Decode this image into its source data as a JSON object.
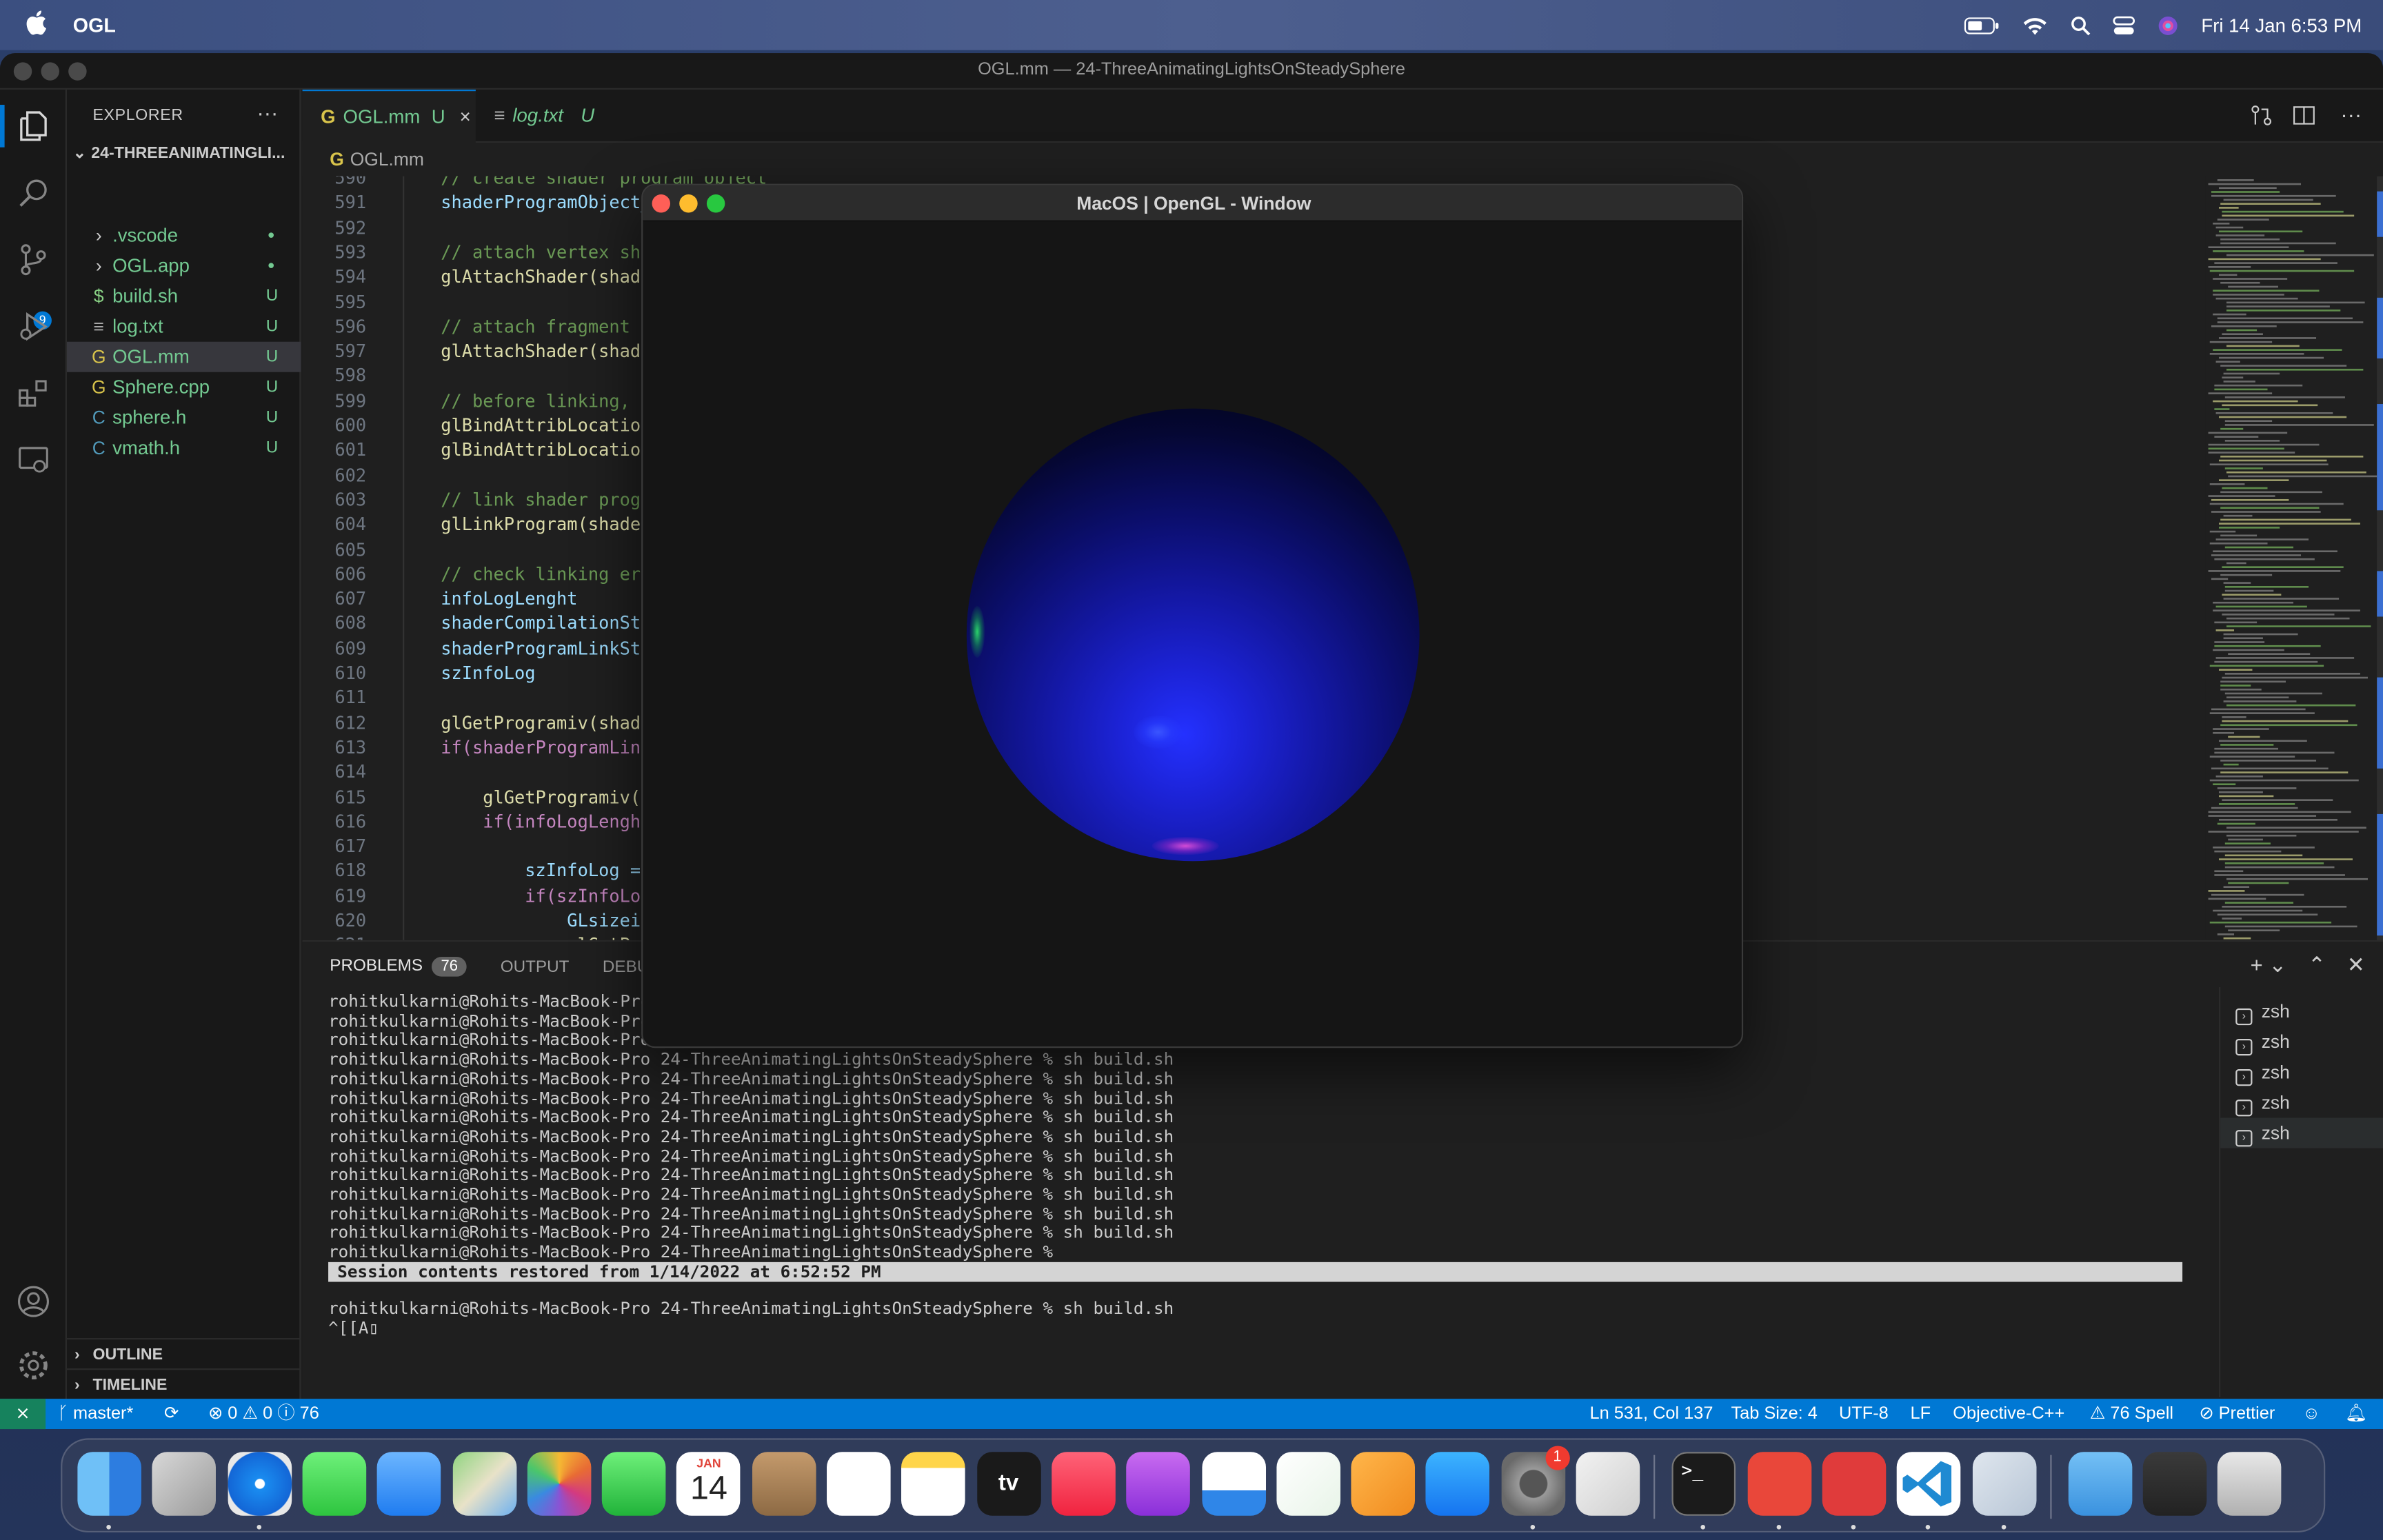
{
  "menubar": {
    "app_name": "OGL",
    "datetime": "Fri 14 Jan  6:53 PM",
    "icons": [
      "apple-logo",
      "battery-icon",
      "wifi-icon",
      "spotlight-search-icon",
      "control-center-icon",
      "siri-icon"
    ]
  },
  "window": {
    "title": "OGL.mm — 24-ThreeAnimatingLightsOnSteadySphere"
  },
  "sidebar": {
    "header": "EXPLORER",
    "more": "···",
    "root": "24-THREEANIMATINGLI...",
    "files": [
      {
        "icon": "›",
        "name": ".vscode",
        "status": "●"
      },
      {
        "icon": "›",
        "name": "OGL.app",
        "status": "●"
      },
      {
        "icon": "$",
        "name": "build.sh",
        "status": "U"
      },
      {
        "icon": "≡",
        "name": "log.txt",
        "status": "U"
      },
      {
        "icon": "G",
        "name": "OGL.mm",
        "status": "U"
      },
      {
        "icon": "G",
        "name": "Sphere.cpp",
        "status": "U"
      },
      {
        "icon": "C",
        "name": "sphere.h",
        "status": "U"
      },
      {
        "icon": "C",
        "name": "vmath.h",
        "status": "U"
      }
    ],
    "outline": "OUTLINE",
    "timeline": "TIMELINE"
  },
  "tabs": [
    {
      "label": "OGL.mm",
      "status": "U",
      "close": "×"
    },
    {
      "label": "log.txt",
      "status": "U"
    }
  ],
  "breadcrumb": "OGL.mm",
  "editor": {
    "lines": [
      {
        "n": "590",
        "t": "// create shader program object",
        "k": "cm"
      },
      {
        "n": "591",
        "t": "shaderProgramObject_",
        "k": "vr"
      },
      {
        "n": "592",
        "t": "",
        "k": ""
      },
      {
        "n": "593",
        "t": "// attach vertex sha",
        "k": "cm"
      },
      {
        "n": "594",
        "t": "glAttachShader(shade",
        "k": "fn"
      },
      {
        "n": "595",
        "t": "",
        "k": ""
      },
      {
        "n": "596",
        "t": "// attach fragment s",
        "k": "cm"
      },
      {
        "n": "597",
        "t": "glAttachShader(shade",
        "k": "fn"
      },
      {
        "n": "598",
        "t": "",
        "k": ""
      },
      {
        "n": "599",
        "t": "// before linking, b",
        "k": "cm"
      },
      {
        "n": "600",
        "t": "glBindAttribLocation",
        "k": "fn"
      },
      {
        "n": "601",
        "t": "glBindAttribLocation",
        "k": "fn"
      },
      {
        "n": "602",
        "t": "",
        "k": ""
      },
      {
        "n": "603",
        "t": "// link shader progr",
        "k": "cm"
      },
      {
        "n": "604",
        "t": "glLinkProgram(shader",
        "k": "fn"
      },
      {
        "n": "605",
        "t": "",
        "k": ""
      },
      {
        "n": "606",
        "t": "// check linking err",
        "k": "cm"
      },
      {
        "n": "607",
        "t": "infoLogLenght",
        "k": "vr"
      },
      {
        "n": "608",
        "t": "shaderCompilationSta",
        "k": "vr"
      },
      {
        "n": "609",
        "t": "shaderProgramLinkSta",
        "k": "vr"
      },
      {
        "n": "610",
        "t": "szInfoLog",
        "k": "vr"
      },
      {
        "n": "611",
        "t": "",
        "k": ""
      },
      {
        "n": "612",
        "t": "glGetProgramiv(shade",
        "k": "fn"
      },
      {
        "n": "613",
        "t": "if(shaderProgramLink",
        "k": "kw"
      },
      {
        "n": "614",
        "t": "",
        "k": ""
      },
      {
        "n": "615",
        "t": "    glGetProgramiv(s",
        "k": "fn"
      },
      {
        "n": "616",
        "t": "    if(infoLogLenght",
        "k": "kw"
      },
      {
        "n": "617",
        "t": "",
        "k": ""
      },
      {
        "n": "618",
        "t": "        szInfoLog =",
        "k": "vr"
      },
      {
        "n": "619",
        "t": "        if(szInfoLog",
        "k": "kw"
      },
      {
        "n": "620",
        "t": "            GLsizei",
        "k": "vr"
      },
      {
        "n": "621",
        "t": "            glGetP",
        "k": "fn"
      }
    ]
  },
  "panel": {
    "tabs": [
      "PROBLEMS",
      "OUTPUT",
      "DEBUG"
    ],
    "problems_count": "76",
    "controls": [
      "+ ⌄",
      "⌃",
      "✕"
    ],
    "terminal_lines": [
      "rohitkulkarni@Rohits-MacBook-Pro",
      "rohitkulkarni@Rohits-MacBook-Pro",
      "rohitkulkarni@Rohits-MacBook-Pro",
      "rohitkulkarni@Rohits-MacBook-Pro 24-ThreeAnimatingLightsOnSteadySphere % sh build.sh",
      "rohitkulkarni@Rohits-MacBook-Pro 24-ThreeAnimatingLightsOnSteadySphere % sh build.sh",
      "rohitkulkarni@Rohits-MacBook-Pro 24-ThreeAnimatingLightsOnSteadySphere % sh build.sh",
      "rohitkulkarni@Rohits-MacBook-Pro 24-ThreeAnimatingLightsOnSteadySphere % sh build.sh",
      "rohitkulkarni@Rohits-MacBook-Pro 24-ThreeAnimatingLightsOnSteadySphere % sh build.sh",
      "rohitkulkarni@Rohits-MacBook-Pro 24-ThreeAnimatingLightsOnSteadySphere % sh build.sh",
      "rohitkulkarni@Rohits-MacBook-Pro 24-ThreeAnimatingLightsOnSteadySphere % sh build.sh",
      "rohitkulkarni@Rohits-MacBook-Pro 24-ThreeAnimatingLightsOnSteadySphere % sh build.sh",
      "rohitkulkarni@Rohits-MacBook-Pro 24-ThreeAnimatingLightsOnSteadySphere % sh build.sh",
      "rohitkulkarni@Rohits-MacBook-Pro 24-ThreeAnimatingLightsOnSteadySphere % sh build.sh",
      "rohitkulkarni@Rohits-MacBook-Pro 24-ThreeAnimatingLightsOnSteadySphere %"
    ],
    "restored": "Session contents restored from 1/14/2022 at 6:52:52 PM",
    "prompt": "rohitkulkarni@Rohits-MacBook-Pro 24-ThreeAnimatingLightsOnSteadySphere % sh build.sh",
    "input": "^[[A▯",
    "shells": [
      "zsh",
      "zsh",
      "zsh",
      "zsh",
      "zsh"
    ]
  },
  "statusbar": {
    "branch": "master*",
    "problems": "⊗ 0 ⚠ 0 ⓘ 76",
    "position": "Ln 531, Col 137",
    "tab_size": "Tab Size: 4",
    "encoding": "UTF-8",
    "eol": "LF",
    "language": "Objective-C++",
    "spell": "⚠ 76 Spell",
    "prettier": "⊘ Prettier"
  },
  "gl_window": {
    "title": "MacOS | OpenGL - Window"
  },
  "dock": {
    "calendar_month": "JAN",
    "calendar_day": "14",
    "tv_label": "tv",
    "settings_badge": "1",
    "apps": [
      "finder-icon",
      "launchpad-icon",
      "safari-icon",
      "messages-icon",
      "mail-icon",
      "maps-icon",
      "photos-icon",
      "facetime-icon",
      "calendar-icon",
      "contacts-icon",
      "reminders-icon",
      "notes-icon",
      "apple-tv-icon",
      "music-icon",
      "podcasts-icon",
      "keynote-icon",
      "numbers-icon",
      "pages-icon",
      "app-store-icon",
      "system-preferences-icon",
      "script-editor-icon",
      "terminal-icon",
      "git-icon",
      "git-client-icon",
      "vscode-icon",
      "preview-icon",
      "downloads-folder-icon",
      "screenshot-stack-icon",
      "trash-icon"
    ]
  },
  "colors": {
    "accent": "#0078d4",
    "untracked": "#73c991",
    "status_bar": "#0078d4"
  }
}
